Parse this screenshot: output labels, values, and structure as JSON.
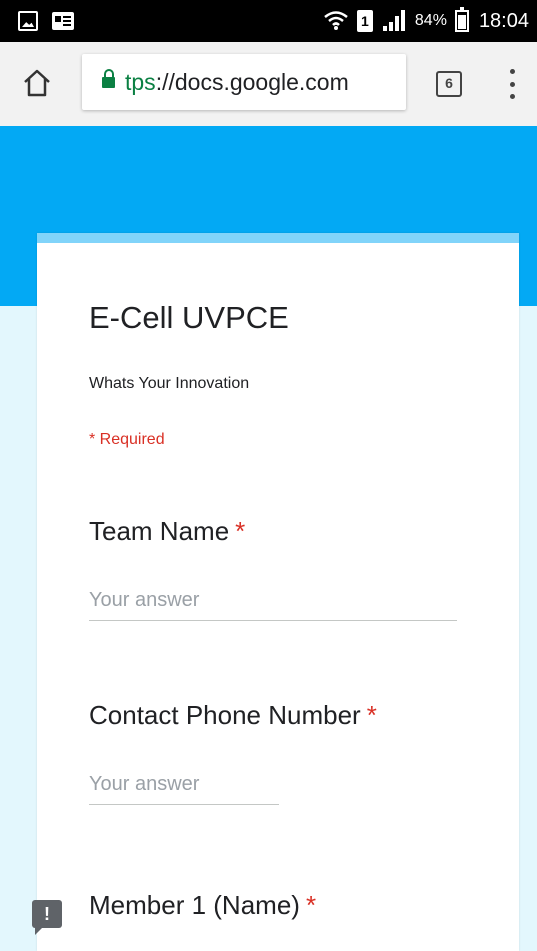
{
  "status_bar": {
    "battery_percent": "84%",
    "time": "18:04",
    "sim_slot": "1",
    "icons": [
      "gallery-icon",
      "card-icon",
      "wifi-icon",
      "sim-icon",
      "signal-icon",
      "battery-icon"
    ]
  },
  "browser": {
    "url_scheme": "tps",
    "url_rest": "://docs.google.com",
    "tab_count": "6",
    "icons": [
      "home-icon",
      "lock-icon",
      "tabs-icon",
      "overflow-menu-icon"
    ]
  },
  "colors": {
    "header_band": "#03a9f4",
    "card_accent": "#81d4fa",
    "page_bg": "#e3f7fd",
    "required": "#d93025",
    "secure": "#0b8043"
  },
  "form": {
    "title": "E-Cell UVPCE",
    "description": "Whats Your Innovation",
    "required_note": "* Required",
    "questions": [
      {
        "label": "Team Name",
        "required_mark": "*",
        "placeholder": "Your answer"
      },
      {
        "label": "Contact Phone Number",
        "required_mark": "*",
        "placeholder": "Your answer"
      },
      {
        "label": "Member 1 (Name)",
        "required_mark": "*"
      }
    ]
  },
  "feedback": {
    "glyph": "!"
  }
}
